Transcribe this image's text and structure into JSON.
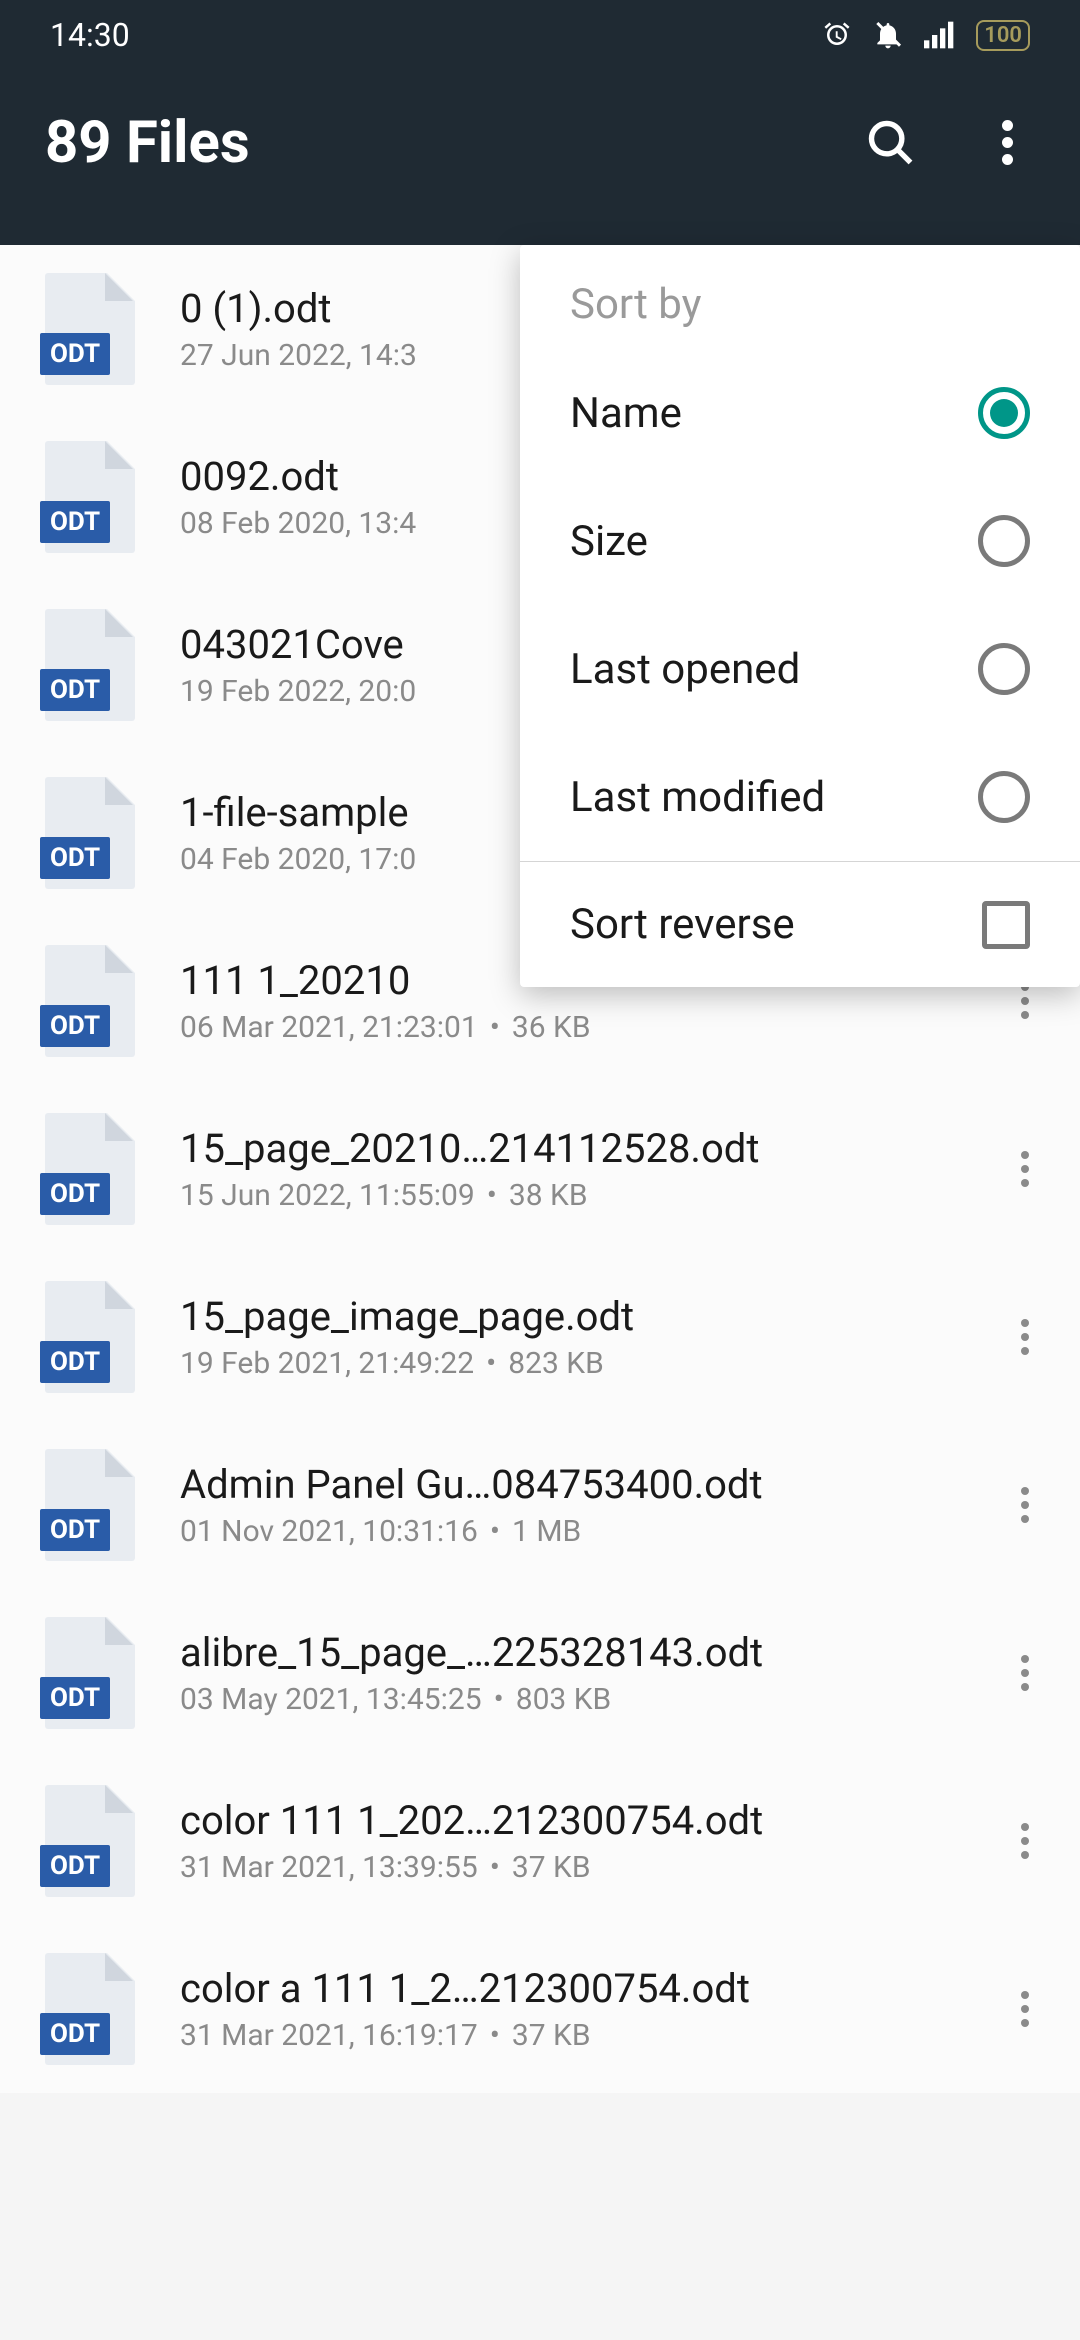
{
  "status": {
    "time": "14:30",
    "battery": "100"
  },
  "app": {
    "title": "89 Files"
  },
  "files": [
    {
      "name": "0 (1).odt",
      "date": "27 Jun 2022, 14:3",
      "size": "",
      "badge": "ODT"
    },
    {
      "name": "0092.odt",
      "date": "08 Feb 2020, 13:4",
      "size": "",
      "badge": "ODT"
    },
    {
      "name": "043021Cove",
      "date": "19 Feb 2022, 20:0",
      "size": "",
      "badge": "ODT"
    },
    {
      "name": "1-file-sample",
      "date": "04 Feb 2020, 17:0",
      "size": "",
      "badge": "ODT"
    },
    {
      "name": "111 1_20210",
      "date": "06 Mar 2021, 21:23:01",
      "size": "36 KB",
      "badge": "ODT"
    },
    {
      "name": "15_page_20210…214112528.odt",
      "date": "15 Jun 2022, 11:55:09",
      "size": "38 KB",
      "badge": "ODT"
    },
    {
      "name": "15_page_image_page.odt",
      "date": "19 Feb 2021, 21:49:22",
      "size": "823 KB",
      "badge": "ODT"
    },
    {
      "name": "Admin Panel Gu…084753400.odt",
      "date": "01 Nov 2021, 10:31:16",
      "size": "1 MB",
      "badge": "ODT"
    },
    {
      "name": "alibre_15_page_…225328143.odt",
      "date": "03 May 2021, 13:45:25",
      "size": "803 KB",
      "badge": "ODT"
    },
    {
      "name": "color 111 1_202…212300754.odt",
      "date": "31 Mar 2021, 13:39:55",
      "size": "37 KB",
      "badge": "ODT"
    },
    {
      "name": "color a 111 1_2…212300754.odt",
      "date": "31 Mar 2021, 16:19:17",
      "size": "37 KB",
      "badge": "ODT"
    }
  ],
  "sort": {
    "header": "Sort by",
    "options": [
      {
        "label": "Name",
        "selected": true
      },
      {
        "label": "Size",
        "selected": false
      },
      {
        "label": "Last opened",
        "selected": false
      },
      {
        "label": "Last modified",
        "selected": false
      }
    ],
    "reverse": {
      "label": "Sort reverse",
      "checked": false
    }
  }
}
